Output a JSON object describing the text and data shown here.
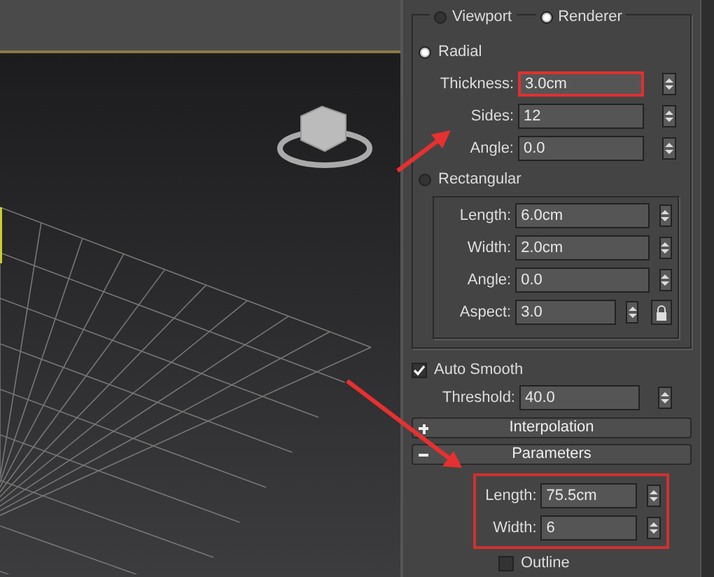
{
  "render_mode": [
    {
      "label": "Viewport",
      "selected": false
    },
    {
      "label": "Renderer",
      "selected": true
    }
  ],
  "radial": {
    "label": "Radial",
    "selected": true,
    "fields": [
      {
        "label": "Thickness:",
        "value": "3.0cm",
        "highlighted": true
      },
      {
        "label": "Sides:",
        "value": "12",
        "highlighted": false
      },
      {
        "label": "Angle:",
        "value": "0.0",
        "highlighted": false
      }
    ]
  },
  "rectangular": {
    "label": "Rectangular",
    "selected": false,
    "fields": [
      {
        "label": "Length:",
        "value": "6.0cm",
        "kind": "spinner"
      },
      {
        "label": "Width:",
        "value": "2.0cm",
        "kind": "spinner"
      },
      {
        "label": "Angle:",
        "value": "0.0",
        "kind": "spinner"
      },
      {
        "label": "Aspect:",
        "value": "3.0",
        "kind": "lock"
      }
    ]
  },
  "auto_smooth": {
    "label": "Auto Smooth",
    "checked": true
  },
  "threshold": {
    "label": "Threshold:",
    "value": "40.0"
  },
  "rollouts": [
    {
      "label": "Interpolation",
      "expanded": false
    },
    {
      "label": "Parameters",
      "expanded": true
    }
  ],
  "parameters": {
    "highlighted": true,
    "fields": [
      {
        "label": "Length:",
        "value": "75.5cm"
      },
      {
        "label": "Width:",
        "value": "6"
      }
    ]
  },
  "outline": {
    "label": "Outline",
    "checked": false
  }
}
